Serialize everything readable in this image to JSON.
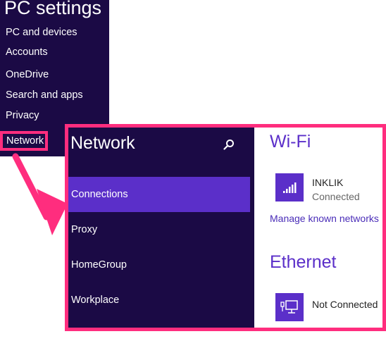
{
  "sidebar": {
    "title": "PC settings",
    "items": [
      {
        "label": "PC and devices"
      },
      {
        "label": "Accounts"
      },
      {
        "label": "OneDrive"
      },
      {
        "label": "Search and apps"
      },
      {
        "label": "Privacy"
      },
      {
        "label": "Network"
      }
    ],
    "highlighted_item": "Network"
  },
  "network_panel": {
    "title": "Network",
    "search_icon": "search-icon",
    "items": [
      {
        "label": "Connections",
        "active": true
      },
      {
        "label": "Proxy"
      },
      {
        "label": "HomeGroup"
      },
      {
        "label": "Workplace"
      }
    ]
  },
  "wifi": {
    "title": "Wi-Fi",
    "network_name": "INKLIK",
    "status": "Connected",
    "manage_link": "Manage known networks",
    "icon": "wifi-signal-icon"
  },
  "ethernet": {
    "title": "Ethernet",
    "status": "Not Connected",
    "icon": "ethernet-icon"
  },
  "colors": {
    "dark_panel": "#1b0a45",
    "accent": "#5b2fc9",
    "highlight": "#ff2d7e"
  }
}
